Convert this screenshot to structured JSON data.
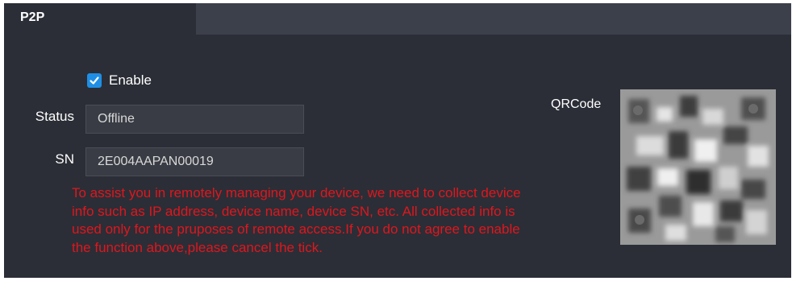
{
  "tab": {
    "label": "P2P"
  },
  "enable": {
    "label": "Enable",
    "checked": true
  },
  "status": {
    "label": "Status",
    "value": "Offline"
  },
  "sn": {
    "label": "SN",
    "value": "2E004AAPAN00019"
  },
  "notice": [
    "To assist you in remotely managing your device, we need to collect device",
    "info such as IP address, device name, device SN, etc. All collected info is",
    "used only for the pruposes of remote access.If you do not agree to enable",
    "the function above,please cancel the tick."
  ],
  "qr": {
    "label": "QRCode"
  },
  "colors": {
    "background": "#2b2e36",
    "tab_bar": "#3c404b",
    "accent": "#1f8fe6",
    "warning_text": "#e0161e"
  }
}
